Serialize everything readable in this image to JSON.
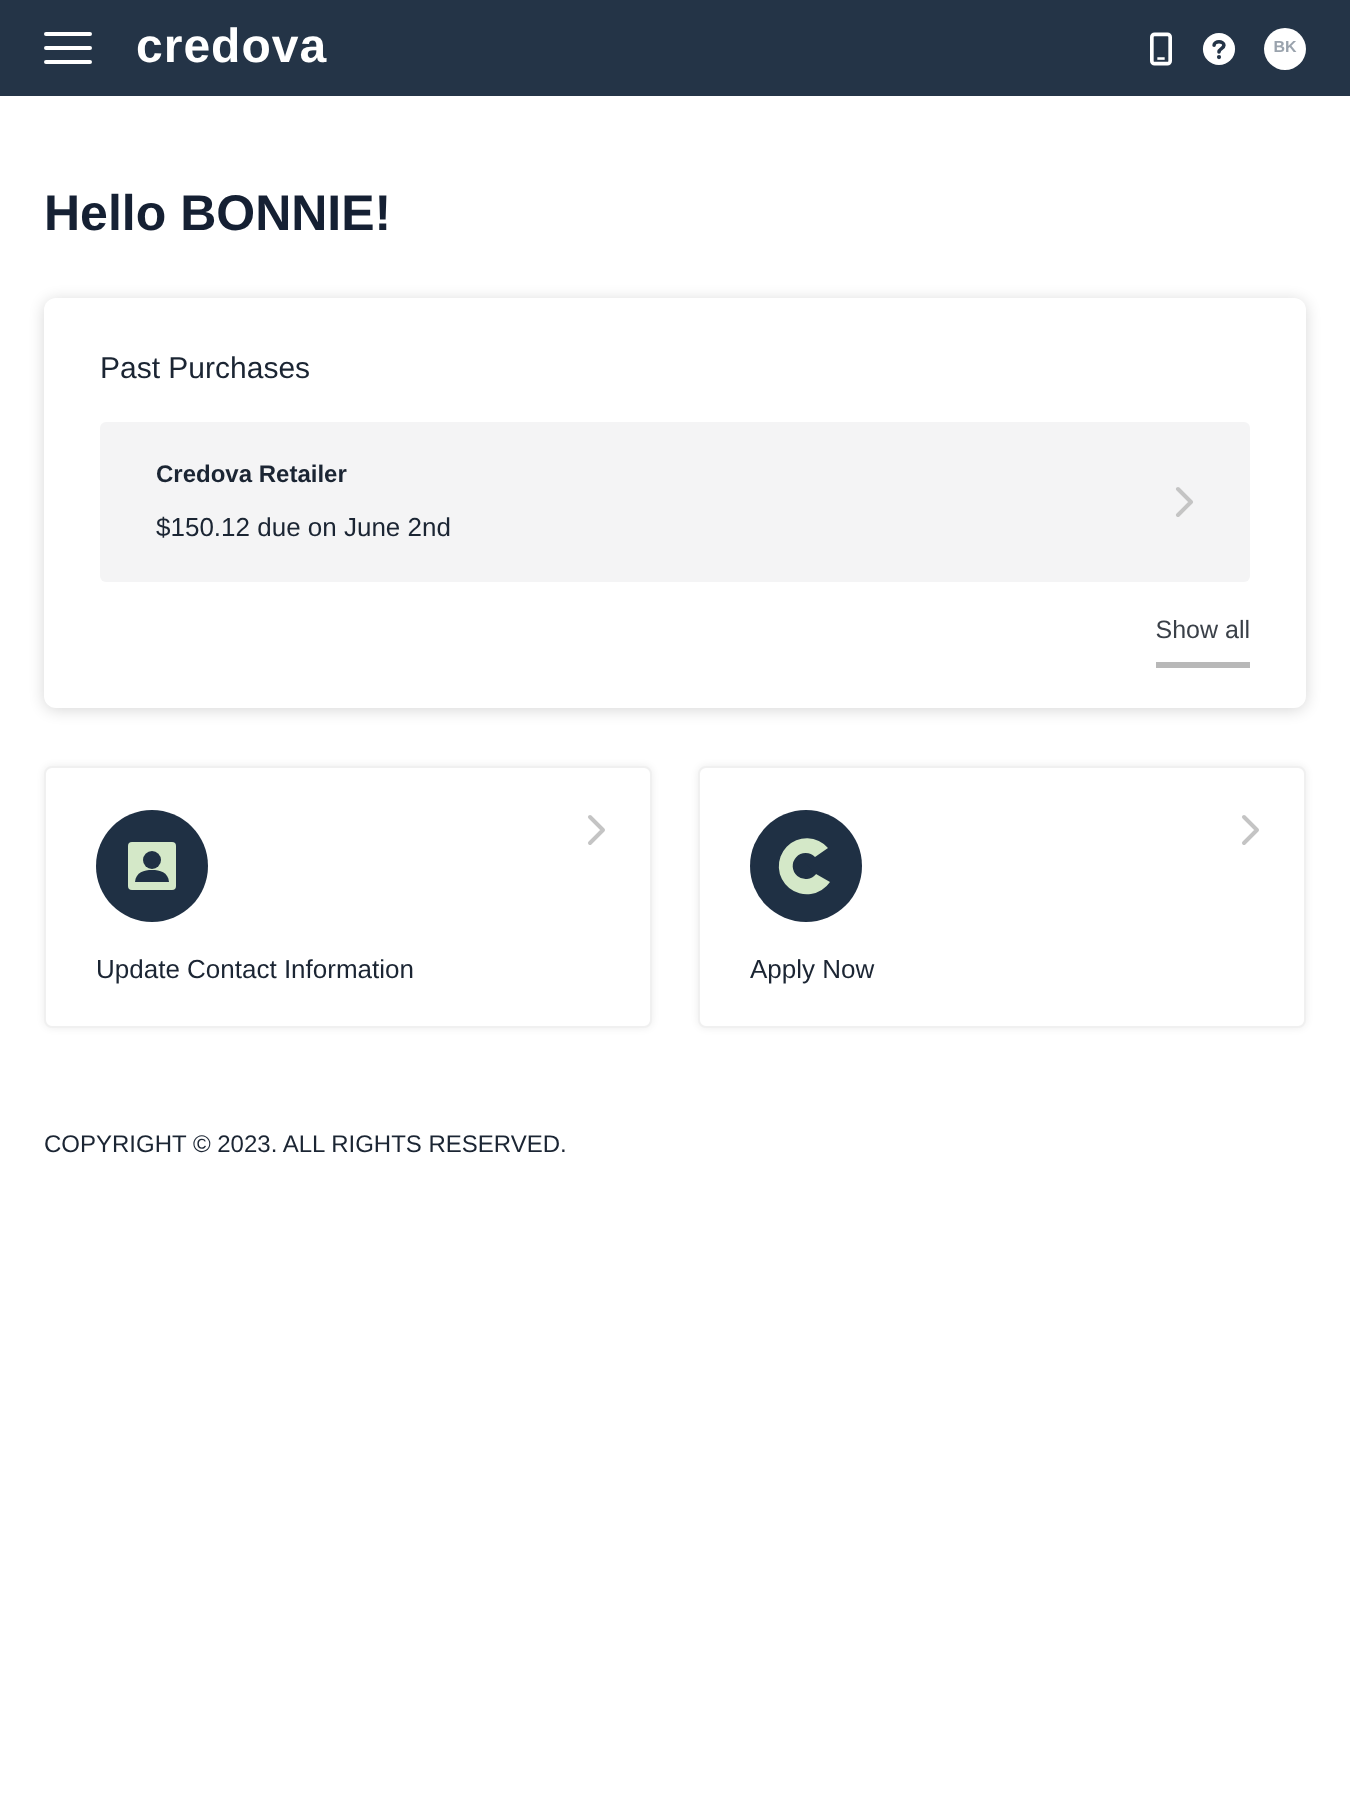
{
  "header": {
    "logo": "credova",
    "avatar_initials": "BK"
  },
  "greeting": "Hello BONNIE!",
  "past_purchases": {
    "title": "Past Purchases",
    "items": [
      {
        "merchant": "Credova Retailer",
        "due": "$150.12 due on June 2nd"
      }
    ],
    "show_all": "Show all"
  },
  "tiles": [
    {
      "kind": "contact",
      "label": "Update Contact Information"
    },
    {
      "kind": "apply",
      "label": "Apply Now"
    }
  ],
  "footer": {
    "copyright": "COPYRIGHT © 2023. ALL RIGHTS RESERVED."
  }
}
